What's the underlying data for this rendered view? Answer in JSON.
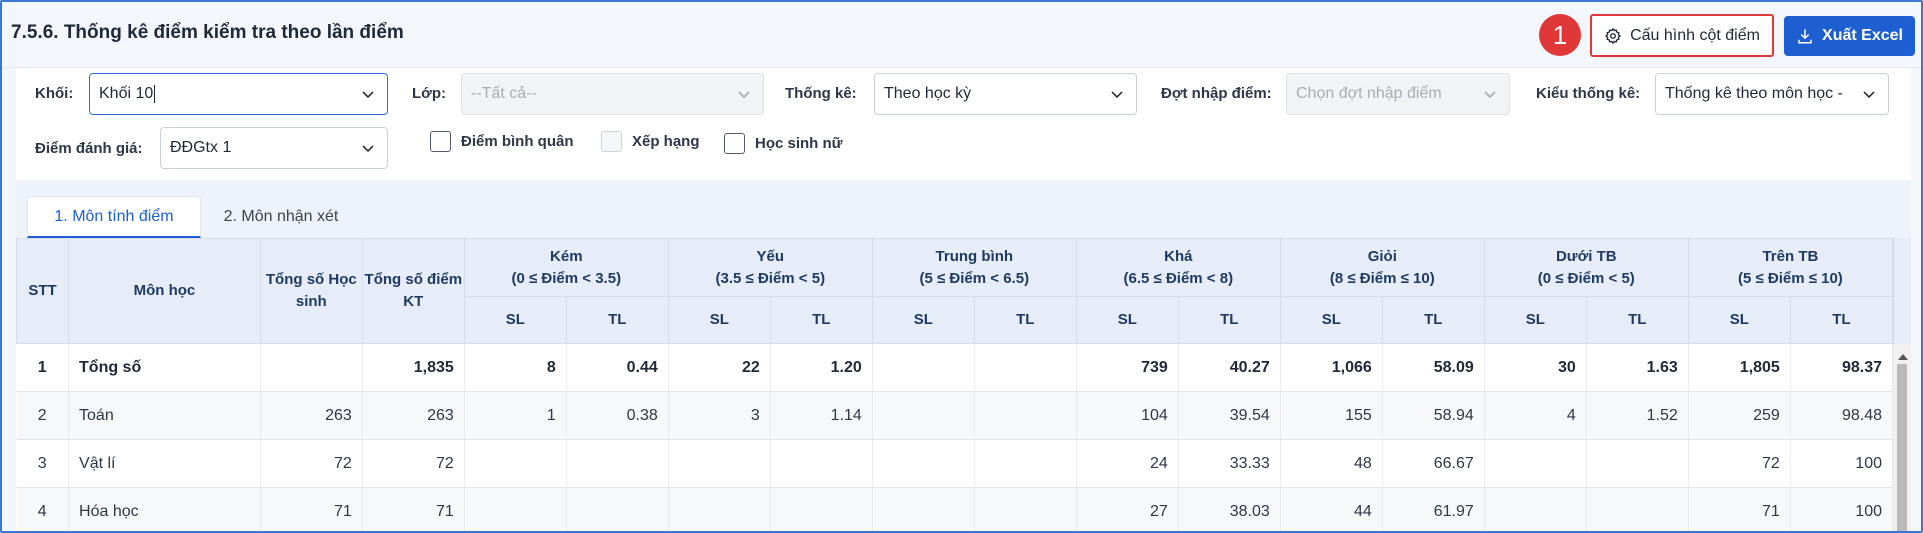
{
  "header": {
    "title": "7.5.6. Thống kê điểm kiểm tra theo lần điểm",
    "step_badge": "1",
    "config_label": "Cấu hình cột điểm",
    "export_label": "Xuất Excel"
  },
  "filters": {
    "khoi_label": "Khối:",
    "khoi_value": "Khối 10",
    "lop_label": "Lớp:",
    "lop_value": "--Tất cả--",
    "thongke_label": "Thống kê:",
    "thongke_value": "Theo học kỳ",
    "dot_label": "Đợt nhập điểm:",
    "dot_placeholder": "Chọn đợt nhập điểm",
    "kieu_label": "Kiểu thống kê:",
    "kieu_value": "Thống kê theo môn học -",
    "danhgia_label": "Điểm đánh giá:",
    "danhgia_value": "ĐĐGtx 1",
    "chk_binhquan": "Điểm bình quân",
    "chk_xephang": "Xếp hạng",
    "chk_nu": "Học sinh nữ"
  },
  "tabs": [
    {
      "label": "1. Môn tính điểm",
      "active": true
    },
    {
      "label": "2. Môn nhận xét",
      "active": false
    }
  ],
  "table": {
    "col_stt": "STT",
    "col_mon": "Môn học",
    "col_tong_hs": "Tổng số Học sinh",
    "col_tong_kt": "Tổng số điểm KT",
    "groups": [
      {
        "name": "Kém",
        "range": "(0 ≤ Điểm < 3.5)"
      },
      {
        "name": "Yếu",
        "range": "(3.5 ≤ Điểm < 5)"
      },
      {
        "name": "Trung bình",
        "range": "(5 ≤ Điểm < 6.5)"
      },
      {
        "name": "Khá",
        "range": "(6.5 ≤ Điểm < 8)"
      },
      {
        "name": "Giỏi",
        "range": "(8 ≤ Điểm ≤ 10)"
      },
      {
        "name": "Dưới TB",
        "range": "(0 ≤ Điểm < 5)"
      },
      {
        "name": "Trên TB",
        "range": "(5 ≤ Điểm ≤ 10)"
      }
    ],
    "sub_sl": "SL",
    "sub_tl": "TL",
    "rows": [
      {
        "stt": "1",
        "mon": "Tổng số",
        "hs": "",
        "kt": "1,835",
        "v": [
          "8",
          "0.44",
          "22",
          "1.20",
          "",
          "",
          "739",
          "40.27",
          "1,066",
          "58.09",
          "30",
          "1.63",
          "1,805",
          "98.37"
        ]
      },
      {
        "stt": "2",
        "mon": "Toán",
        "hs": "263",
        "kt": "263",
        "v": [
          "1",
          "0.38",
          "3",
          "1.14",
          "",
          "",
          "104",
          "39.54",
          "155",
          "58.94",
          "4",
          "1.52",
          "259",
          "98.48"
        ]
      },
      {
        "stt": "3",
        "mon": "Vật lí",
        "hs": "72",
        "kt": "72",
        "v": [
          "",
          "",
          "",
          "",
          "",
          "",
          "24",
          "33.33",
          "48",
          "66.67",
          "",
          "",
          "72",
          "100"
        ]
      },
      {
        "stt": "4",
        "mon": "Hóa học",
        "hs": "71",
        "kt": "71",
        "v": [
          "",
          "",
          "",
          "",
          "",
          "",
          "27",
          "38.03",
          "44",
          "61.97",
          "",
          "",
          "71",
          "100"
        ]
      }
    ]
  },
  "colors": {
    "accent": "#1d5fd0",
    "highlight": "#e03838",
    "header_bg": "#e6edf8"
  }
}
